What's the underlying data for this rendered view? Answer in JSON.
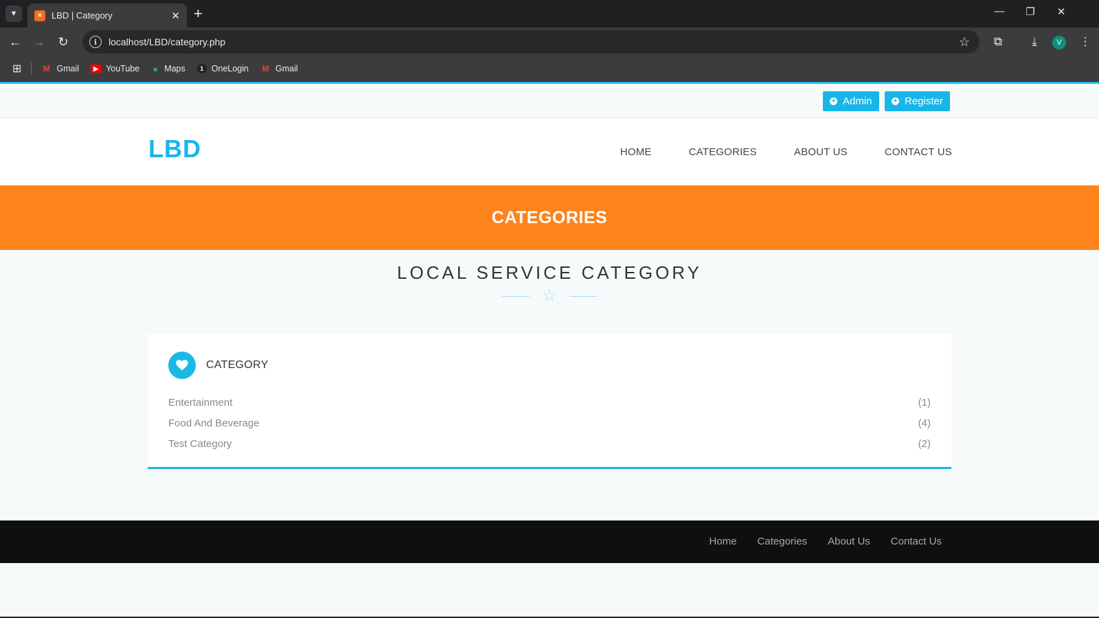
{
  "browser": {
    "tab_title": "LBD | Category",
    "url": "localhost/LBD/category.php",
    "profile_initial": "V",
    "bookmarks": [
      {
        "label": "Gmail",
        "icon": "gmail-icon"
      },
      {
        "label": "YouTube",
        "icon": "youtube-icon"
      },
      {
        "label": "Maps",
        "icon": "maps-icon"
      },
      {
        "label": "OneLogin",
        "icon": "onelogin-icon"
      },
      {
        "label": "Gmail",
        "icon": "gmail-icon"
      }
    ]
  },
  "topbar": {
    "admin_label": "Admin",
    "register_label": "Register"
  },
  "header": {
    "logo": "LBD",
    "nav": [
      "HOME",
      "CATEGORIES",
      "ABOUT US",
      "CONTACT US"
    ]
  },
  "banner": {
    "title": "CATEGORIES"
  },
  "section": {
    "title": "LOCAL SERVICE CATEGORY"
  },
  "card": {
    "title": "CATEGORY",
    "items": [
      {
        "name": "Entertainment",
        "count": "(1)"
      },
      {
        "name": "Food And Beverage",
        "count": "(4)"
      },
      {
        "name": "Test Category",
        "count": "(2)"
      }
    ]
  },
  "footer": {
    "links": [
      "Home",
      "Categories",
      "About Us",
      "Contact Us"
    ]
  },
  "colors": {
    "accent": "#19b9e6",
    "banner": "#fe831c",
    "footer": "#0e0f10"
  }
}
